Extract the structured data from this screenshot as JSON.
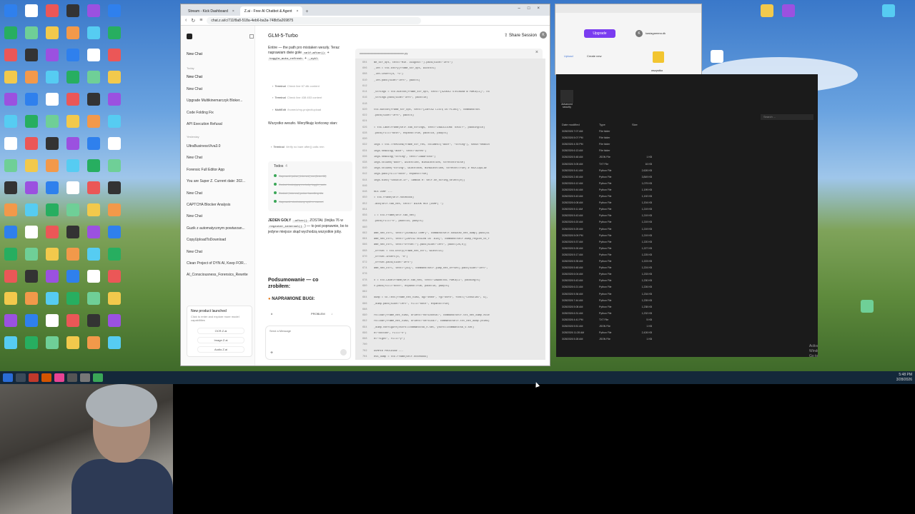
{
  "browser": {
    "tabs": [
      {
        "label": "Stream - Kick Dashboard"
      },
      {
        "label": "Z.ai - Free AI Chatbot & Agent"
      }
    ],
    "url": "chat.z.ai/c/711f8a8-518a-4eb6-ba3a-748b5a269875"
  },
  "sidebar": {
    "new_chat": "New Chat",
    "section_today": "Today",
    "section_yesterday": "Yesterday",
    "items_today": [
      "New Chat",
      "New Chat",
      "Upgrade Multikinemarczyk Bloker...",
      "Code Folding Fix",
      "API Execution Refusal"
    ],
    "items_yesterday": [
      "UltraBusinessViva3.0",
      "New Chat",
      "Forensic Full Editor App",
      "You are Super Z. Current date: 202...",
      "New Chat",
      "CAPTCHA Blocker Analysis",
      "New Chat",
      "Guzik z automatycznym powtarzan...",
      "CopyUploadToDownload",
      "New Chat",
      "Clean Project of DYN AI, Keep FOR...",
      "AI_Consciousness_Forensics_Rewrite"
    ],
    "promo": {
      "title": "New product launched",
      "desc": "Click to enter and explore more model capabilities",
      "links": [
        "OCR.Z.ai",
        "Image.Z.ai",
        "Audio.Z.ai"
      ]
    }
  },
  "chat": {
    "title": "GLM-5-Turbo",
    "intro": "Entire — the path pro mistaken weszły. Teraz naprawiam dwie gołe",
    "chip1": "self.after()",
    "chip_and": "+",
    "chip2": "toggle_auto_refresh",
    "chip3": "_cykl",
    "tools": [
      {
        "name": "Terminal",
        "detail": "Check line 67 dtk content"
      },
      {
        "name": "Terminal",
        "detail": "Check line 438 453 content"
      },
      {
        "name": "MultiEdit",
        "detail": "/home/z/my-project/upload"
      }
    ],
    "msg2": "Wszystko weszło. Weryfikuję końcowy stan:",
    "tool4": {
      "name": "Terminal",
      "detail": "Verify no bare after() calls rem"
    },
    "todos_label": "Todos",
    "todos_count": "4",
    "todos": [
      "Naprawić pulse_interval_ms (linia 46)",
      "Dodać brakującą metodę toggle_auto",
      "Dodać _interval_pulse handling dla",
      "Naprawić niechciany cykl — cancel"
    ],
    "msg3_a": "JEDEN GOŁY",
    "msg3_chip": ".after()",
    "msg3_b": "ZOSTAŁ (linijka 76 w",
    "msg3_chip2": "register_interval()",
    "msg3_c": ") — to jest poprawnie, bo to jedyne miejsce skąd wychodzą wszystkie joby.",
    "summary_title": "Podsumowanie — co zrobiłem:",
    "fixed_bugs": "NAPRAWIONE BUGI:",
    "table_col1": "#",
    "table_col2": "PROBLEM",
    "composer_placeholder": "Send a Message"
  },
  "code_panel": {
    "share": "Share Session",
    "avatar": "K",
    "filename": "ccccccccccccccccccccccccccccccc.py",
    "line_numbers": [
      "604",
      "605",
      "606",
      "607",
      "608",
      "609",
      "610",
      "611",
      "612",
      "613",
      "614",
      "615",
      "616",
      "617",
      "618",
      "619",
      "620",
      "621",
      "622",
      "623",
      "624",
      "625",
      "626",
      "627",
      "628",
      "629",
      "630",
      "631",
      "632",
      "633",
      "634",
      "635",
      "636",
      "637",
      "638",
      "639",
      "640",
      "641",
      "642",
      "643",
      "644",
      "645",
      "646",
      "647",
      "648",
      "649",
      "650",
      "651",
      "652",
      "653",
      "654",
      "655",
      "656",
      "657",
      "658",
      "659",
      "660",
      "661",
      "662",
      "663",
      "664",
      "665",
      "666",
      "667",
      "668",
      "669",
      "670",
      "671",
      "672",
      "673",
      "674",
      "675",
      "676",
      "677",
      "678",
      "679",
      "680",
      "681",
      "682",
      "683",
      "684",
      "685",
      "686",
      "687",
      "688",
      "689",
      "690",
      "691",
      "692",
      "693",
      "694",
      "695",
      "696",
      "697",
      "698",
      "699",
      "700",
      "701",
      "702",
      "703",
      "704",
      "705",
      "706",
      "707",
      "708",
      "709",
      "710",
      "711",
      "712",
      "713",
      "714",
      "715",
      "716"
    ],
    "lines": [
      "me_str_opt, text=\"Min. Długość:\").pack(side=\"left\")",
      "_len = ttk.Entry(frame_str_opt, width=5)",
      "_len.insert(0, \"5\")",
      "_len.pack(side=\"left\", padx=5)",
      "",
      "_strings = ttk.Button(frame_str_opt, text=\"[SZUKAJ STRINGÓW W PAMIĘCI]\", co",
      "_strings.pack(side=\"left\", padx=10)",
      "",
      "ttk.Button(frame_str_opt, text=\"[ZAPISZ LISTĘ DO PLIKU]\", command=sel",
      ".pack(side=\"left\", padx=5)",
      "",
      "= ttk.LabelFrame(self.tab_strings, text=\"ZNALEZIONE TEKSTY\", padding=10)",
      ".pack(fill=\"both\", expand=True, padx=10, pady=5)",
      "",
      "ings = ttk.Treeview(frame_str_res, columns=(\"addr\", \"string\"), show=\"headin",
      "ings.heading(\"addr\", text=\"Adres\")",
      "ings.heading(\"string\", text=\"Zawartość\")",
      "ings.column(\"addr\", width=100, minwidth=100, stretch=False)",
      "ings.column(\"string\", width=800, minwidth=300, stretch=True)  # ROZCIĄGLIW",
      "ings.pack(fill=\"both\", expand=True)",
      "ings.bind(\"<Double-1>\", lambda e: self.on_string_select(e))",
      "",
      "HEX DUMP ---",
      "= ttk.Frame(self.notebook)",
      ".add(self.tab_hex, text=\" WIDOK HEX (DUMP) \")",
      "",
      "l = ttk.Frame(self.tab_hex)",
      ".pack(fill=\"x\", padx=10, pady=5)",
      "",
      "ame_hex_ctrl, text=\"[ODŚWIEŻ DUMP]\", command=self.odswiez_hex_dump).pack(si",
      "ame_hex_ctrl, text=\"[ZAPISZ REGION DO .BIN]\", command=self.dump_region_to_f",
      "ame_hex_ctrl, text=\"Offset:\").pack(side=\"left\", padx=(20,0))",
      "_offset = ttk.Entry(frame_hex_ctrl, width=15)",
      "_offset.insert(0, \"0\")",
      "_offset.pack(side=\"left\")",
      "ame_hex_ctrl, text=\"[GO]\", command=self.jump_hex_offset).pack(side=\"left\",",
      "",
      "x = ttk.LabelFrame(self.tab_hex, text=\"ZAWARTOŚĆ PAMIĘCI\", padding=5)",
      "x.pack(fill=\"both\", expand=True, padx=10, pady=5)",
      "",
      "dump = tk.Text(frame_hex_view, bg=\"#000\", fg=\"#0F0\", font=(\"Consolas\", 9),",
      "_dump.pack(side=\"left\", fill=\"both\", expand=True)",
      "",
      "rollbar(frame_hex_view, orient=\"horizontal\", command=self.txt_hex_dump.xvie",
      "rollbar(frame_hex_view, orient=\"vertical\", command=self.txt_hex_dump.yview)",
      "_dump.configure(xscrollcommand=sb_h.set, yscrollcommand=sb_v.set)",
      "e=\"bottom\", fill=\"x\")",
      "e=\"right\", fill=\"y\")",
      "",
      "DUMPER PROCESÓW ---",
      "ess_dump = ttk.Frame(self.notebook)"
    ]
  },
  "browser2": {
    "upgrade": "Upgrade",
    "account_initial": "K",
    "account_name": "kasiagamma.dk",
    "upload": "Upload",
    "create": "Create new",
    "folder": "wszystko"
  },
  "explorer": {
    "search_placeholder": "Search ...",
    "advanced": "Advanced security",
    "col_date": "Date modified",
    "col_type": "Type",
    "col_size": "Size",
    "rows": [
      {
        "date": "3/28/2026 7:07 AM",
        "type": "File folder",
        "size": ""
      },
      {
        "date": "3/28/2026 5:07 PM",
        "type": "File folder",
        "size": ""
      },
      {
        "date": "3/28/2026 4:33 PM",
        "type": "File folder",
        "size": ""
      },
      {
        "date": "3/28/2026 6:13 AM",
        "type": "File folder",
        "size": ""
      },
      {
        "date": "3/28/2026 5:48 AM",
        "type": "JSON File",
        "size": "1 KB"
      },
      {
        "date": "3/28/2026 3:05 AM",
        "type": "TXT File",
        "size": "16 KB"
      },
      {
        "date": "3/28/2026 5:41 AM",
        "type": "Python File",
        "size": "2,626 KB"
      },
      {
        "date": "3/28/2026 2:45 AM",
        "type": "Python File",
        "size": "3,849 KB"
      },
      {
        "date": "3/28/2026 6:12 AM",
        "type": "Python File",
        "size": "1,079 KB"
      },
      {
        "date": "3/28/2026 5:44 AM",
        "type": "Python File",
        "size": "1,199 KB"
      },
      {
        "date": "3/28/2026 5:43 AM",
        "type": "Python File",
        "size": "1,192 KB"
      },
      {
        "date": "3/28/2026 6:08 AM",
        "type": "Python File",
        "size": "1,204 KB"
      },
      {
        "date": "3/28/2026 5:11 AM",
        "type": "Python File",
        "size": "1,219 KB"
      },
      {
        "date": "3/28/2026 5:43 AM",
        "type": "Python File",
        "size": "1,219 KB"
      },
      {
        "date": "3/28/2026 6:20 AM",
        "type": "Python File",
        "size": "1,219 KB"
      },
      {
        "date": "3/28/2026 5:25 AM",
        "type": "Python File",
        "size": "1,219 KB"
      },
      {
        "date": "3/28/2026 5:09 PM",
        "type": "Python File",
        "size": "1,219 KB"
      },
      {
        "date": "3/28/2026 5:37 AM",
        "type": "Python File",
        "size": "1,220 KB"
      },
      {
        "date": "3/28/2026 5:26 AM",
        "type": "Python File",
        "size": "1,227 KB"
      },
      {
        "date": "3/28/2026 5:17 AM",
        "type": "Python File",
        "size": "1,225 KB"
      },
      {
        "date": "3/28/2026 5:35 AM",
        "type": "Python File",
        "size": "1,223 KB"
      },
      {
        "date": "3/28/2026 5:48 AM",
        "type": "Python File",
        "size": "1,224 KB"
      },
      {
        "date": "3/28/2026 6:04 AM",
        "type": "Python File",
        "size": "1,233 KB"
      },
      {
        "date": "3/28/2026 5:43 AM",
        "type": "Python File",
        "size": "1,230 KB"
      },
      {
        "date": "3/28/2026 6:21 AM",
        "type": "Python File",
        "size": "1,226 KB"
      },
      {
        "date": "3/28/2026 5:36 AM",
        "type": "Python File",
        "size": "1,234 KB"
      },
      {
        "date": "3/28/2026 7:44 AM",
        "type": "Python File",
        "size": "1,239 KB"
      },
      {
        "date": "3/28/2026 5:08 AM",
        "type": "Python File",
        "size": "1,238 KB"
      },
      {
        "date": "3/28/2026 6:31 AM",
        "type": "Python File",
        "size": "1,232 KB"
      },
      {
        "date": "3/28/2026 4:41 PM",
        "type": "TXT File",
        "size": "5 KB"
      },
      {
        "date": "3/28/2026 5:51 AM",
        "type": "JSON File",
        "size": "1 KB"
      },
      {
        "date": "3/28/2026 11:28 AM",
        "type": "Python File",
        "size": "2,426 KB"
      },
      {
        "date": "3/28/2026 5:28 AM",
        "type": "JSON File",
        "size": "1 KB"
      }
    ],
    "activate": "Activate Windows\nGo to Settings to activate Windows."
  },
  "taskbar": {
    "time": "5:48 PM",
    "date": "3/28/2026"
  },
  "colors": {
    "upgrade": "#7a3cf0",
    "todo_done": "#3aa657",
    "taskbar": "#14283a",
    "explorer_bg": "#1b1b1b"
  }
}
